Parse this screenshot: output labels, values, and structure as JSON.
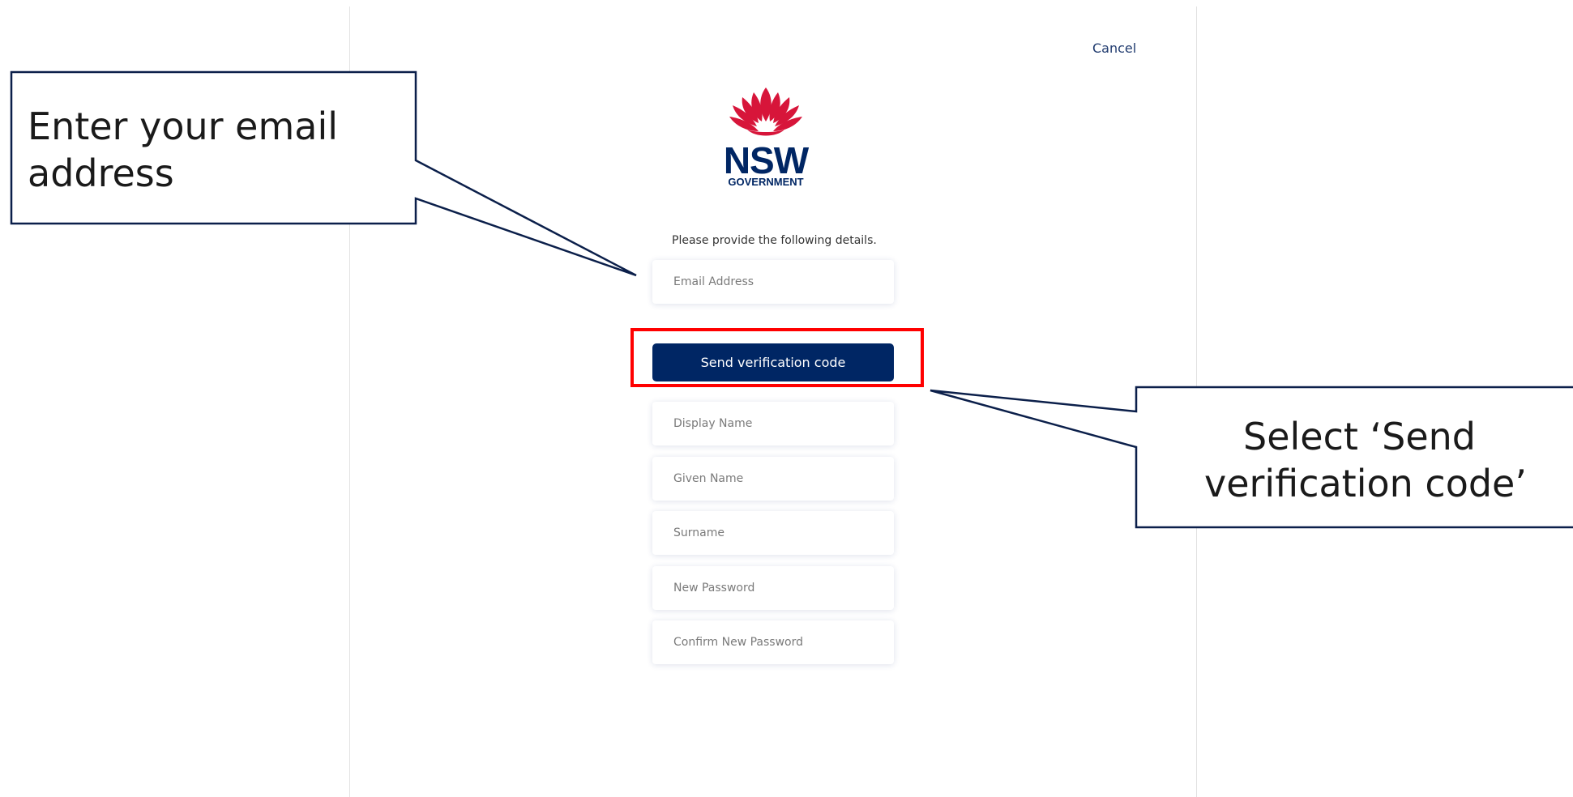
{
  "header": {
    "cancel_label": "Cancel"
  },
  "logo": {
    "wordmark": "NSW",
    "subtitle": "GOVERNMENT"
  },
  "form": {
    "intro": "Please provide the following details.",
    "email_placeholder": "Email Address",
    "send_code_label": "Send verification code",
    "display_name_placeholder": "Display Name",
    "given_name_placeholder": "Given Name",
    "surname_placeholder": "Surname",
    "new_password_placeholder": "New Password",
    "confirm_password_placeholder": "Confirm New Password"
  },
  "annotations": {
    "email_callout_line1": "Enter your email",
    "email_callout_line2": "address",
    "send_callout_line1": "Select ‘Send",
    "send_callout_line2": "verification code’"
  },
  "colors": {
    "brand_navy": "#002664",
    "brand_red": "#d7153a",
    "highlight_red": "#ff0000",
    "callout_stroke": "#0b1f4a"
  }
}
